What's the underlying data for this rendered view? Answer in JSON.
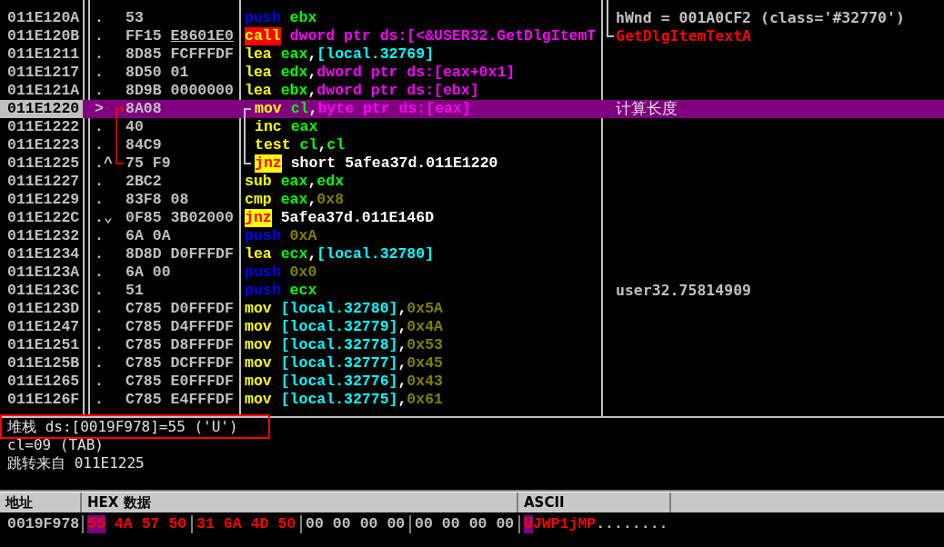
{
  "disassembly": {
    "rows": [
      {
        "address": "011E120A",
        "selected": false,
        "in_loop": false,
        "marker": ".",
        "bytes": [
          {
            "text": "53",
            "underlined": false
          }
        ],
        "tokens": [
          {
            "kind": "push",
            "text": "push"
          },
          {
            "kind": "reg",
            "text": "ebx"
          }
        ],
        "comment": {
          "kind": "arg",
          "text": "hWnd = 001A0CF2 (class='#32770')"
        }
      },
      {
        "address": "011E120B",
        "selected": false,
        "in_loop": false,
        "marker": ".",
        "bytes": [
          {
            "text": "FF15",
            "underlined": false
          },
          {
            "text": "E8601E0",
            "underlined": true
          }
        ],
        "tokens": [
          {
            "kind": "call",
            "text": "call"
          },
          {
            "kind": "mem",
            "text": "dword ptr ds:[<&USER32.GetDlgItemT"
          }
        ],
        "comment": {
          "kind": "api",
          "text": "GetDlgItemTextA"
        }
      },
      {
        "address": "011E1211",
        "selected": false,
        "in_loop": false,
        "marker": ".",
        "bytes": [
          {
            "text": "8D85",
            "underlined": false
          },
          {
            "text": "FCFFFDF",
            "underlined": false
          }
        ],
        "tokens": [
          {
            "kind": "op",
            "text": "lea"
          },
          {
            "kind": "reg",
            "text": "eax"
          },
          {
            "kind": "plain",
            "text": ","
          },
          {
            "kind": "local",
            "text": "[local.32769]"
          }
        ]
      },
      {
        "address": "011E1217",
        "selected": false,
        "in_loop": false,
        "marker": ".",
        "bytes": [
          {
            "text": "8D50",
            "underlined": false
          },
          {
            "text": "01",
            "underlined": false
          }
        ],
        "tokens": [
          {
            "kind": "op",
            "text": "lea"
          },
          {
            "kind": "reg",
            "text": "edx"
          },
          {
            "kind": "plain",
            "text": ","
          },
          {
            "kind": "mem",
            "text": "dword ptr ds:[eax+0x1]"
          }
        ]
      },
      {
        "address": "011E121A",
        "selected": false,
        "in_loop": false,
        "marker": ".",
        "bytes": [
          {
            "text": "8D9B",
            "underlined": false
          },
          {
            "text": "0000000",
            "underlined": false
          }
        ],
        "tokens": [
          {
            "kind": "op",
            "text": "lea"
          },
          {
            "kind": "reg",
            "text": "ebx"
          },
          {
            "kind": "plain",
            "text": ","
          },
          {
            "kind": "mem",
            "text": "dword ptr ds:[ebx]"
          }
        ]
      },
      {
        "address": "011E1220",
        "selected": true,
        "in_loop": true,
        "marker": ">",
        "bytes": [
          {
            "text": "8A08",
            "underlined": false
          }
        ],
        "tokens": [
          {
            "kind": "op",
            "text": "mov"
          },
          {
            "kind": "reg",
            "text": "cl"
          },
          {
            "kind": "plain",
            "text": ","
          },
          {
            "kind": "mem",
            "text": "byte ptr ds:[eax]"
          }
        ],
        "comment": {
          "kind": "note",
          "text": "计算长度"
        }
      },
      {
        "address": "011E1222",
        "selected": false,
        "in_loop": true,
        "marker": ".",
        "bytes": [
          {
            "text": "40",
            "underlined": false
          }
        ],
        "tokens": [
          {
            "kind": "op",
            "text": "inc"
          },
          {
            "kind": "reg",
            "text": "eax"
          }
        ]
      },
      {
        "address": "011E1223",
        "selected": false,
        "in_loop": true,
        "marker": ".",
        "bytes": [
          {
            "text": "84C9",
            "underlined": false
          }
        ],
        "tokens": [
          {
            "kind": "op",
            "text": "test"
          },
          {
            "kind": "reg",
            "text": "cl"
          },
          {
            "kind": "plain",
            "text": ","
          },
          {
            "kind": "reg",
            "text": "cl"
          }
        ]
      },
      {
        "address": "011E1225",
        "selected": false,
        "in_loop": true,
        "marker": ".^",
        "bytes": [
          {
            "text": "75",
            "underlined": false
          },
          {
            "text": "F9",
            "underlined": false
          }
        ],
        "tokens": [
          {
            "kind": "jcc",
            "text": "jnz"
          },
          {
            "kind": "plain",
            "text": "short 5afea37d.011E1220"
          }
        ]
      },
      {
        "address": "011E1227",
        "selected": false,
        "in_loop": false,
        "marker": ".",
        "bytes": [
          {
            "text": "2BC2",
            "underlined": false
          }
        ],
        "tokens": [
          {
            "kind": "op",
            "text": "sub"
          },
          {
            "kind": "reg",
            "text": "eax"
          },
          {
            "kind": "plain",
            "text": ","
          },
          {
            "kind": "reg",
            "text": "edx"
          }
        ]
      },
      {
        "address": "011E1229",
        "selected": false,
        "in_loop": false,
        "marker": ".",
        "bytes": [
          {
            "text": "83F8",
            "underlined": false
          },
          {
            "text": "08",
            "underlined": false
          }
        ],
        "tokens": [
          {
            "kind": "op",
            "text": "cmp"
          },
          {
            "kind": "reg",
            "text": "eax"
          },
          {
            "kind": "plain",
            "text": ","
          },
          {
            "kind": "const",
            "text": "0x8"
          }
        ]
      },
      {
        "address": "011E122C",
        "selected": false,
        "in_loop": false,
        "marker": ".⌄",
        "bytes": [
          {
            "text": "0F85",
            "underlined": false
          },
          {
            "text": "3B02000",
            "underlined": false
          }
        ],
        "tokens": [
          {
            "kind": "jcc",
            "text": "jnz"
          },
          {
            "kind": "plain",
            "text": "5afea37d.011E146D"
          }
        ]
      },
      {
        "address": "011E1232",
        "selected": false,
        "in_loop": false,
        "marker": ".",
        "bytes": [
          {
            "text": "6A",
            "underlined": false
          },
          {
            "text": "0A",
            "underlined": false
          }
        ],
        "tokens": [
          {
            "kind": "push",
            "text": "push"
          },
          {
            "kind": "const",
            "text": "0xA"
          }
        ]
      },
      {
        "address": "011E1234",
        "selected": false,
        "in_loop": false,
        "marker": ".",
        "bytes": [
          {
            "text": "8D8D",
            "underlined": false
          },
          {
            "text": "D0FFFDF",
            "underlined": false
          }
        ],
        "tokens": [
          {
            "kind": "op",
            "text": "lea"
          },
          {
            "kind": "reg",
            "text": "ecx"
          },
          {
            "kind": "plain",
            "text": ","
          },
          {
            "kind": "local",
            "text": "[local.32780]"
          }
        ]
      },
      {
        "address": "011E123A",
        "selected": false,
        "in_loop": false,
        "marker": ".",
        "bytes": [
          {
            "text": "6A",
            "underlined": false
          },
          {
            "text": "00",
            "underlined": false
          }
        ],
        "tokens": [
          {
            "kind": "push",
            "text": "push"
          },
          {
            "kind": "const",
            "text": "0x0"
          }
        ]
      },
      {
        "address": "011E123C",
        "selected": false,
        "in_loop": false,
        "marker": ".",
        "bytes": [
          {
            "text": "51",
            "underlined": false
          }
        ],
        "tokens": [
          {
            "kind": "push",
            "text": "push"
          },
          {
            "kind": "reg",
            "text": "ecx"
          }
        ],
        "comment": {
          "kind": "plain",
          "text": "user32.75814909"
        }
      },
      {
        "address": "011E123D",
        "selected": false,
        "in_loop": false,
        "marker": ".",
        "bytes": [
          {
            "text": "C785",
            "underlined": false
          },
          {
            "text": "D0FFFDF",
            "underlined": false
          }
        ],
        "tokens": [
          {
            "kind": "op",
            "text": "mov"
          },
          {
            "kind": "local",
            "text": "[local.32780]"
          },
          {
            "kind": "plain",
            "text": ","
          },
          {
            "kind": "const",
            "text": "0x5A"
          }
        ]
      },
      {
        "address": "011E1247",
        "selected": false,
        "in_loop": false,
        "marker": ".",
        "bytes": [
          {
            "text": "C785",
            "underlined": false
          },
          {
            "text": "D4FFFDF",
            "underlined": false
          }
        ],
        "tokens": [
          {
            "kind": "op",
            "text": "mov"
          },
          {
            "kind": "local",
            "text": "[local.32779]"
          },
          {
            "kind": "plain",
            "text": ","
          },
          {
            "kind": "const",
            "text": "0x4A"
          }
        ]
      },
      {
        "address": "011E1251",
        "selected": false,
        "in_loop": false,
        "marker": ".",
        "bytes": [
          {
            "text": "C785",
            "underlined": false
          },
          {
            "text": "D8FFFDF",
            "underlined": false
          }
        ],
        "tokens": [
          {
            "kind": "op",
            "text": "mov"
          },
          {
            "kind": "local",
            "text": "[local.32778]"
          },
          {
            "kind": "plain",
            "text": ","
          },
          {
            "kind": "const",
            "text": "0x53"
          }
        ]
      },
      {
        "address": "011E125B",
        "selected": false,
        "in_loop": false,
        "marker": ".",
        "bytes": [
          {
            "text": "C785",
            "underlined": false
          },
          {
            "text": "DCFFFDF",
            "underlined": false
          }
        ],
        "tokens": [
          {
            "kind": "op",
            "text": "mov"
          },
          {
            "kind": "local",
            "text": "[local.32777]"
          },
          {
            "kind": "plain",
            "text": ","
          },
          {
            "kind": "const",
            "text": "0x45"
          }
        ]
      },
      {
        "address": "011E1265",
        "selected": false,
        "in_loop": false,
        "marker": ".",
        "bytes": [
          {
            "text": "C785",
            "underlined": false
          },
          {
            "text": "E0FFFDF",
            "underlined": false
          }
        ],
        "tokens": [
          {
            "kind": "op",
            "text": "mov"
          },
          {
            "kind": "local",
            "text": "[local.32776]"
          },
          {
            "kind": "plain",
            "text": ","
          },
          {
            "kind": "const",
            "text": "0x43"
          }
        ]
      },
      {
        "address": "011E126F",
        "selected": false,
        "in_loop": false,
        "marker": ".",
        "bytes": [
          {
            "text": "C785",
            "underlined": false
          },
          {
            "text": "E4FFFDF",
            "underlined": false
          }
        ],
        "tokens": [
          {
            "kind": "op",
            "text": "mov"
          },
          {
            "kind": "local",
            "text": "[local.32775]"
          },
          {
            "kind": "plain",
            "text": ","
          },
          {
            "kind": "const",
            "text": "0x61"
          }
        ]
      }
    ]
  },
  "info": {
    "lines": [
      {
        "text": "堆栈 ds:[0019F978]=55 ('U')",
        "boxed": true
      },
      {
        "text": "cl=09 (TAB)",
        "boxed": false
      },
      {
        "text": "跳转来自 011E1225",
        "boxed": false
      }
    ]
  },
  "dump": {
    "columns": [
      "地址",
      "HEX 数据",
      "ASCII"
    ],
    "rows": [
      {
        "address": "0019F978",
        "groups": [
          [
            {
              "text": "55",
              "changed": true,
              "selected": true
            },
            {
              "text": "4A",
              "changed": true,
              "selected": false
            },
            {
              "text": "57",
              "changed": true,
              "selected": false
            },
            {
              "text": "50",
              "changed": true,
              "selected": false
            }
          ],
          [
            {
              "text": "31",
              "changed": true,
              "selected": false
            },
            {
              "text": "6A",
              "changed": true,
              "selected": false
            },
            {
              "text": "4D",
              "changed": true,
              "selected": false
            },
            {
              "text": "50",
              "changed": true,
              "selected": false
            }
          ],
          [
            {
              "text": "00",
              "changed": false,
              "selected": false
            },
            {
              "text": "00",
              "changed": false,
              "selected": false
            },
            {
              "text": "00",
              "changed": false,
              "selected": false
            },
            {
              "text": "00",
              "changed": false,
              "selected": false
            }
          ],
          [
            {
              "text": "00",
              "changed": false,
              "selected": false
            },
            {
              "text": "00",
              "changed": false,
              "selected": false
            },
            {
              "text": "00",
              "changed": false,
              "selected": false
            },
            {
              "text": "00",
              "changed": false,
              "selected": false
            }
          ]
        ],
        "ascii": [
          {
            "text": "U",
            "changed": true,
            "selected": true
          },
          {
            "text": "JWP1jMP",
            "changed": true,
            "selected": false
          },
          {
            "text": "........",
            "changed": false,
            "selected": false
          }
        ]
      }
    ]
  }
}
